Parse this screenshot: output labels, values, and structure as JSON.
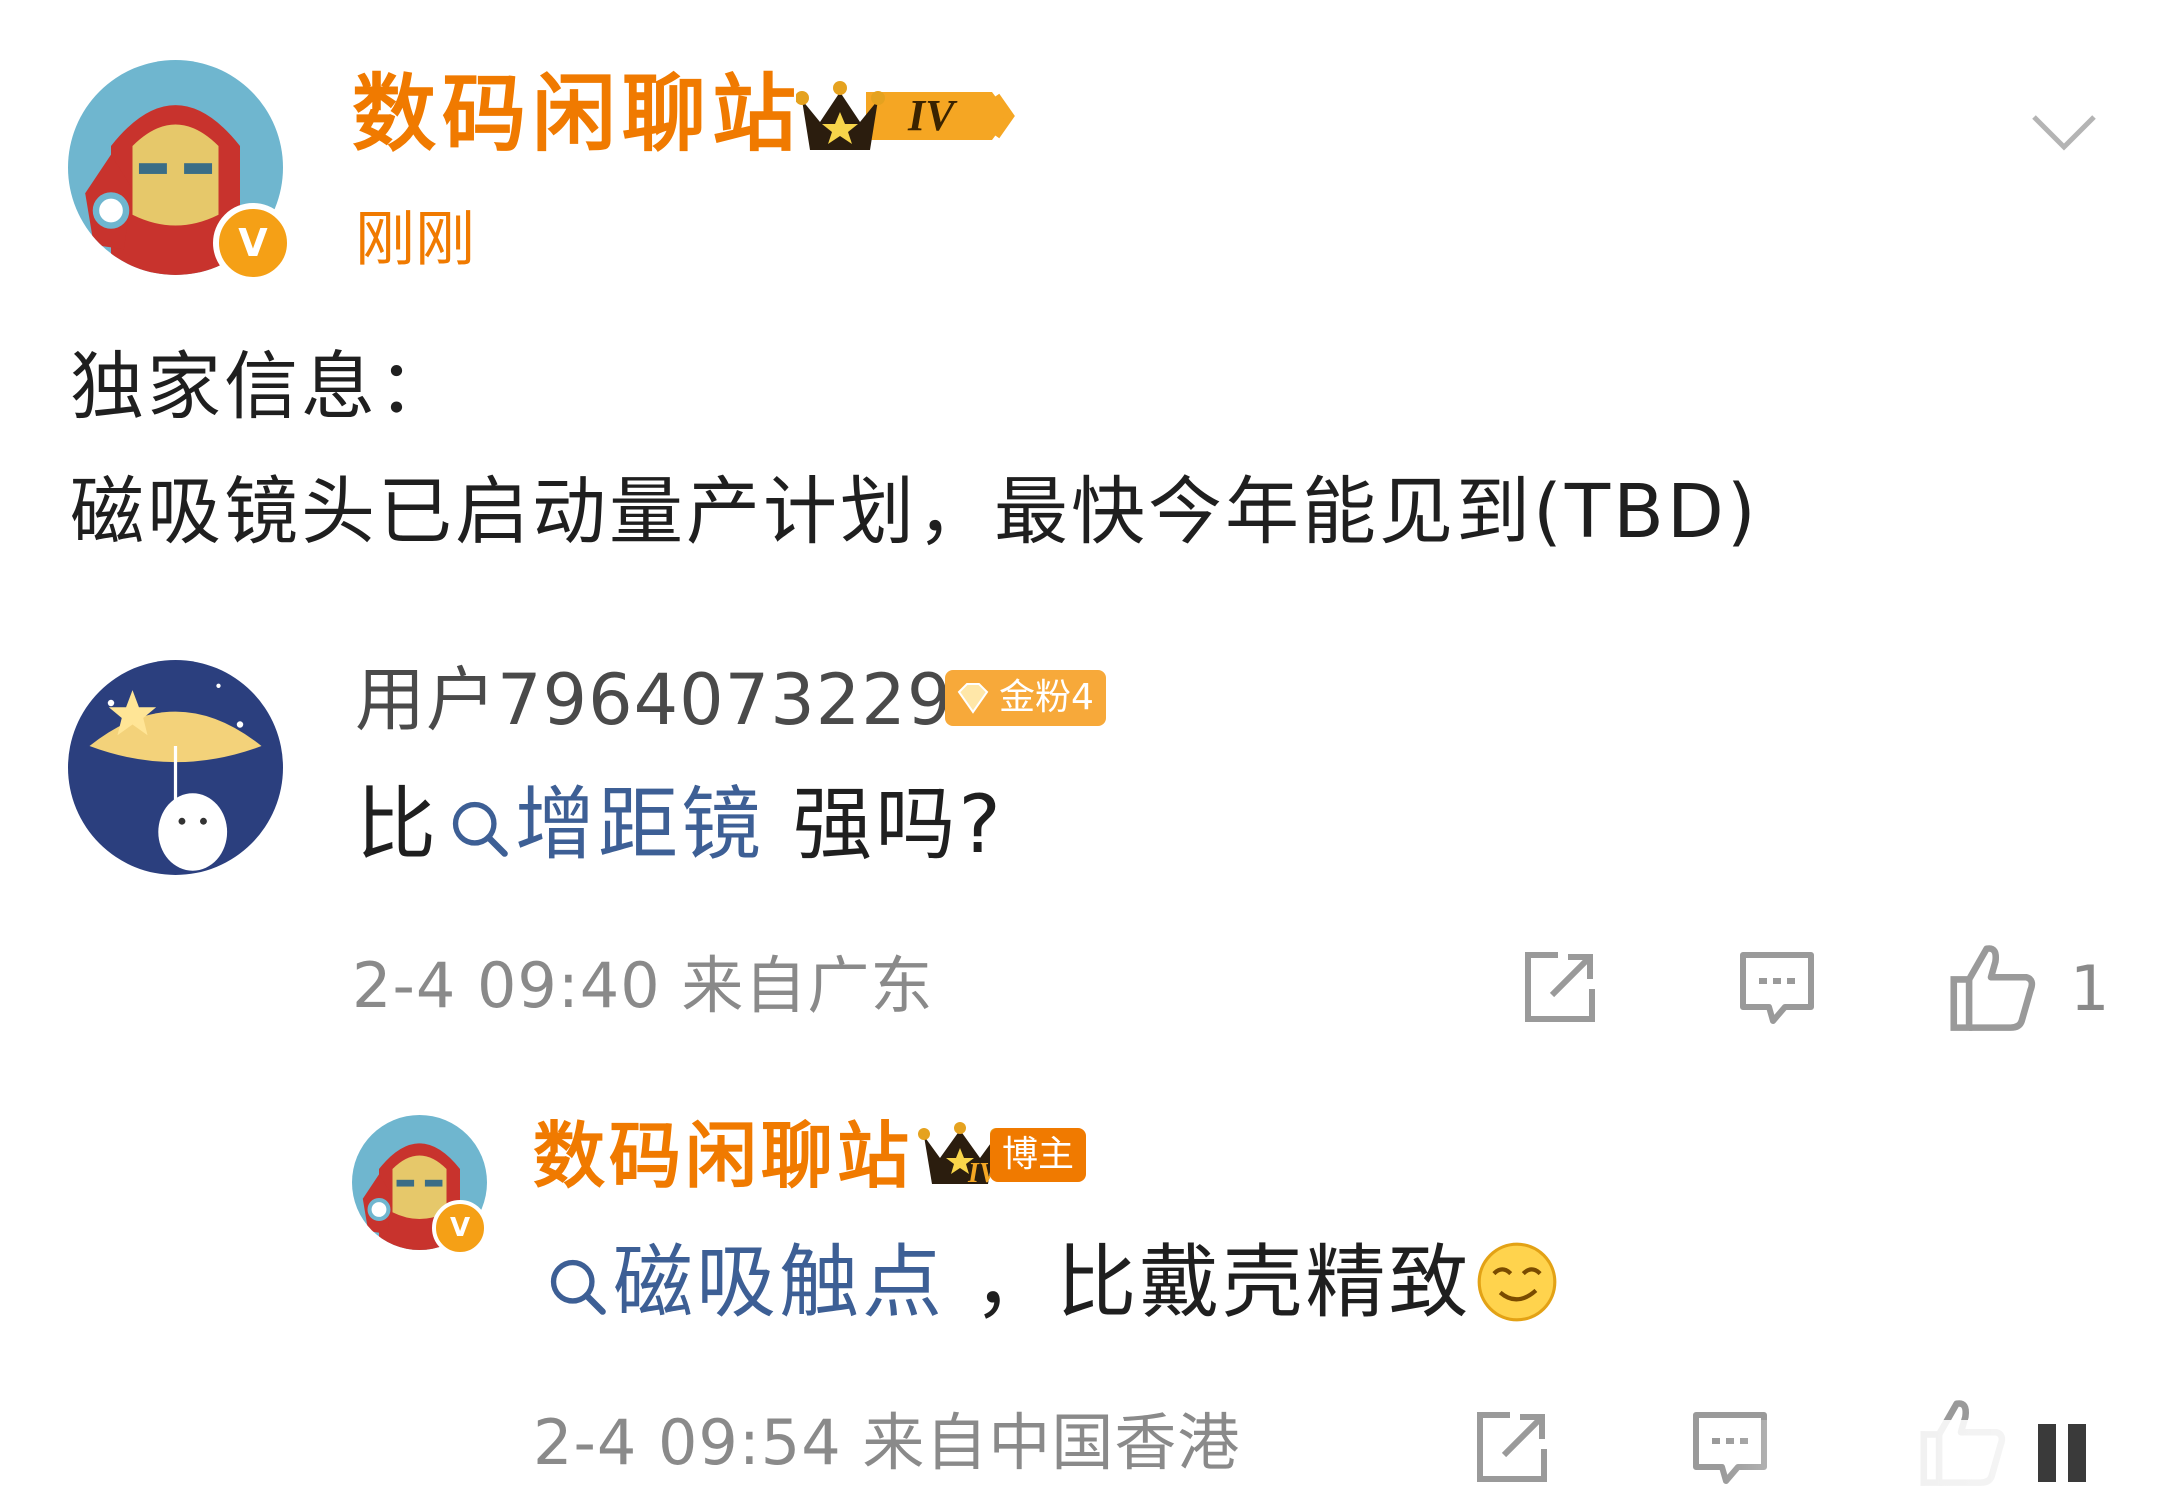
{
  "post": {
    "author": "数码闲聊站",
    "level_badge": "IV",
    "time": "刚刚",
    "lines": [
      "独家信息：",
      "磁吸镜头已启动量产计划，最快今年能见到(TBD)"
    ]
  },
  "comments": [
    {
      "username": "用户7964073229",
      "fan_badge": "金粉4",
      "text_before": "比",
      "topic": "增距镜",
      "text_after": " 强吗?",
      "meta": "2-4 09:40 来自广东",
      "like_count": "1"
    }
  ],
  "reply": {
    "author": "数码闲聊站",
    "crown_level": "IV",
    "host_badge": "博主",
    "topic": "磁吸触点",
    "text_after": " ，比戴壳精致",
    "emoji": "smirk-emoji",
    "meta": "2-4 09:54 来自中国香港"
  },
  "colors": {
    "brand_orange": "#f07a00",
    "topic_blue": "#3d5f95",
    "meta_gray": "#8a8a8a"
  }
}
